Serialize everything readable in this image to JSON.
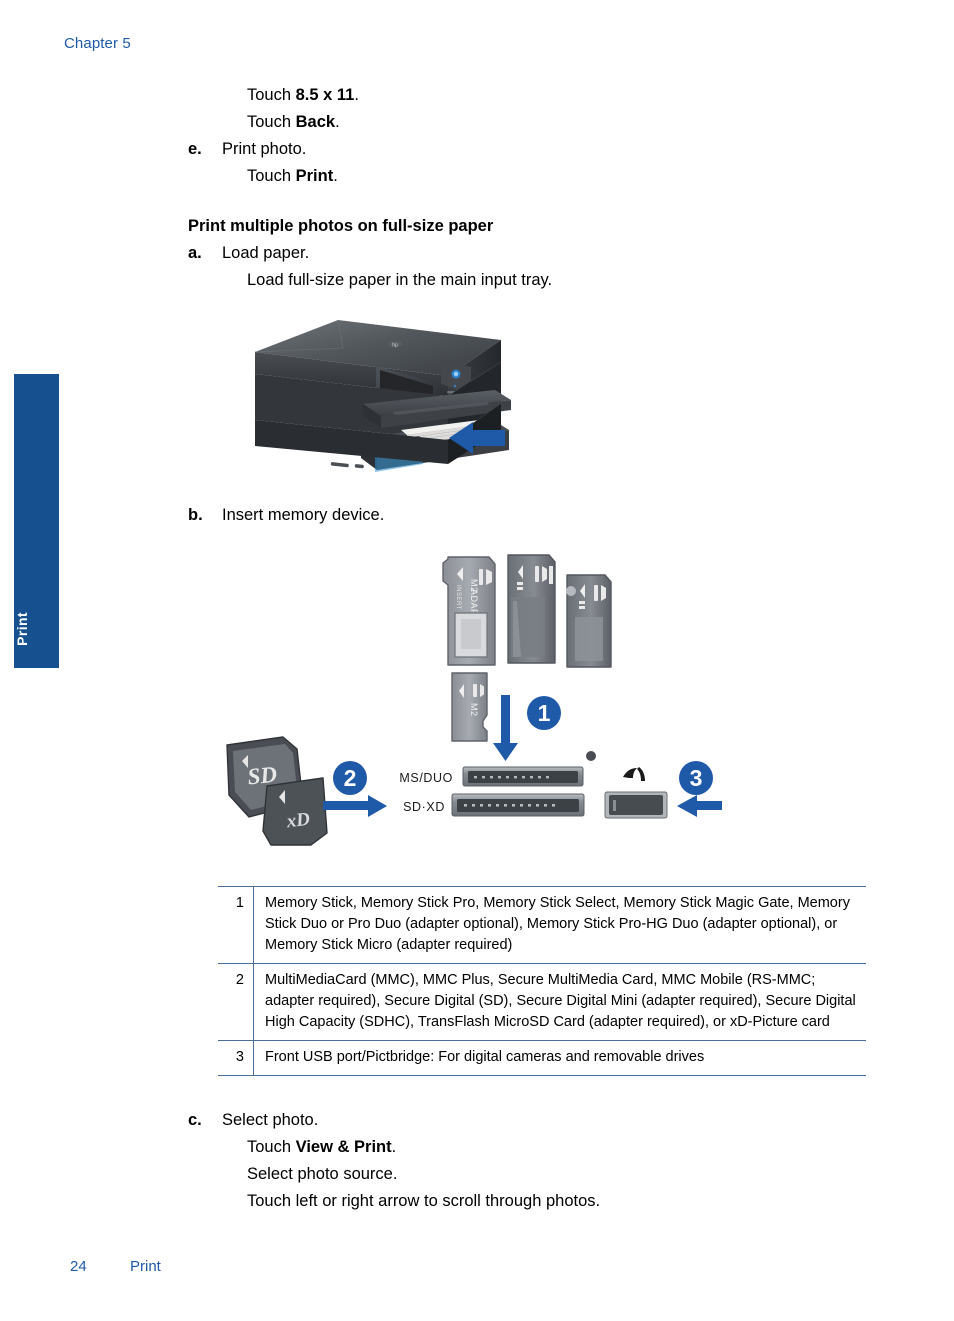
{
  "page": {
    "chapter_label": "Chapter 5",
    "side_tab_label": "Print",
    "footer_page_number": "24",
    "footer_section": "Print",
    "accent_blue": "#1F5AA8",
    "tab_blue": "#16508F",
    "table_rule_color": "#4A6E96"
  },
  "continued_steps": {
    "line_touch_size": "Touch ",
    "line_touch_size_bold": "8.5 x 11",
    "line_touch_size_end": ".",
    "line_touch_back": "Touch ",
    "line_touch_back_bold": "Back",
    "line_touch_back_end": ".",
    "step_e_marker": "e.",
    "step_e_text": "Print photo.",
    "line_touch_print": "Touch ",
    "line_touch_print_bold": "Print",
    "line_touch_print_end": "."
  },
  "section": {
    "heading": "Print multiple photos on full-size paper",
    "step_a_marker": "a.",
    "step_a_text": "Load paper.",
    "step_a_detail": "Load full-size paper in the main input tray.",
    "step_b_marker": "b.",
    "step_b_text": "Insert memory device.",
    "step_c_marker": "c.",
    "step_c_text": "Select photo.",
    "step_c_line1_pre": "Touch ",
    "step_c_line1_bold": "View & Print",
    "step_c_line1_end": ".",
    "step_c_line2": "Select photo source.",
    "step_c_line3": "Touch left or right arrow to scroll through photos."
  },
  "figure_printer": {
    "alt": "HP Photosmart all-in-one printer with main input tray open and a blue arrow pointing into the tray"
  },
  "figure_cards": {
    "alt": "Memory card slots diagram",
    "slot_label_top": "MS/DUO",
    "slot_label_bottom": "SD·XD",
    "callout_1": "1",
    "callout_2": "2",
    "callout_3": "3",
    "card_label_m2_adapter": "M2 ADAPTER",
    "card_label_insert": "INSERT",
    "card_label_m2": "M2",
    "card_label_sd": "SD",
    "card_label_xd": "xD",
    "arrow_color": "#1F5AA8"
  },
  "legend_table": {
    "rows": [
      {
        "num": "1",
        "desc": "Memory Stick, Memory Stick Pro, Memory Stick Select, Memory Stick Magic Gate, Memory Stick Duo or Pro Duo (adapter optional), Memory Stick Pro-HG Duo (adapter optional), or Memory Stick Micro (adapter required)"
      },
      {
        "num": "2",
        "desc": "MultiMediaCard (MMC), MMC Plus, Secure MultiMedia Card, MMC Mobile (RS-MMC; adapter required), Secure Digital (SD), Secure Digital Mini (adapter required), Secure Digital High Capacity (SDHC), TransFlash MicroSD Card (adapter required), or xD-Picture card"
      },
      {
        "num": "3",
        "desc": "Front USB port/Pictbridge: For digital cameras and removable drives"
      }
    ]
  }
}
